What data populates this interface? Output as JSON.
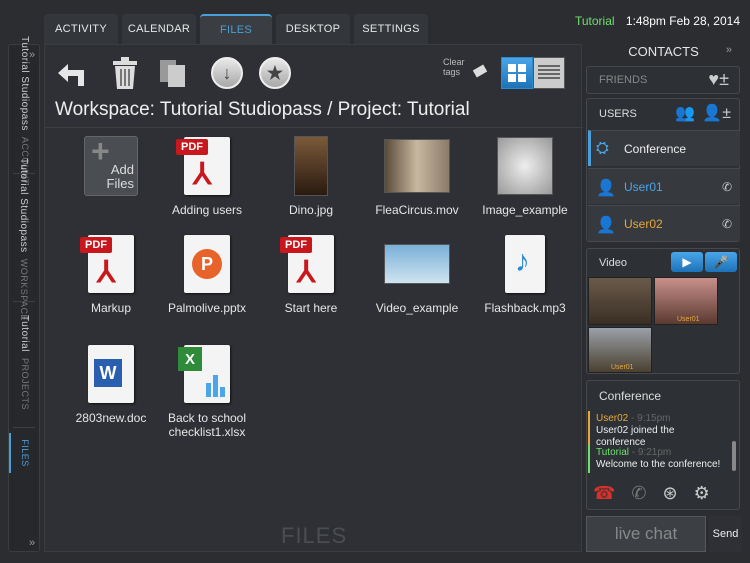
{
  "top_tabs": [
    "ACTIVITY",
    "CALENDAR",
    "FILES",
    "DESKTOP",
    "SETTINGS"
  ],
  "status": {
    "user": "Tutorial",
    "datetime": "1:48pm Feb 28, 2014"
  },
  "left_tabs": [
    {
      "header": "ACCOUNT",
      "value": "Tutorial Studiopass"
    },
    {
      "header": "WORKSPACE",
      "value": "Tutorial Studiopass"
    },
    {
      "header": "PROJECTS",
      "value": "Tutorial"
    },
    {
      "header": "FILES",
      "value": ""
    }
  ],
  "toolbar": {
    "clear_tags": "Clear tags"
  },
  "breadcrumb": "Workspace: Tutorial Studiopass / Project: Tutorial",
  "files": [
    {
      "name": "Add Files",
      "type": "add"
    },
    {
      "name": "Adding users",
      "type": "pdf"
    },
    {
      "name": "Dino.jpg",
      "type": "image"
    },
    {
      "name": "FleaCircus.mov",
      "type": "video"
    },
    {
      "name": "Image_example",
      "type": "image"
    },
    {
      "name": "Markup",
      "type": "pdf"
    },
    {
      "name": "Palmolive.pptx",
      "type": "pptx"
    },
    {
      "name": "Start here",
      "type": "pdf"
    },
    {
      "name": "Video_example",
      "type": "video"
    },
    {
      "name": "Flashback.mp3",
      "type": "audio"
    },
    {
      "name": "2803new.doc",
      "type": "doc"
    },
    {
      "name": "Back to school checklist1.xlsx",
      "type": "xlsx"
    }
  ],
  "add_files_label": "Add Files",
  "pdf_badge": "PDF",
  "footer_label": "FILES",
  "contacts": {
    "title": "CONTACTS",
    "friends": "FRIENDS",
    "users": "USERS",
    "conference": "Conference",
    "user_list": [
      {
        "name": "User01",
        "color": "#4aa6e8"
      },
      {
        "name": "User02",
        "color": "#e8a83a"
      }
    ]
  },
  "video": {
    "title": "Video",
    "tile_labels": [
      "User01",
      "User01"
    ]
  },
  "chat": {
    "title": "Conference",
    "messages": [
      {
        "user": "User02",
        "time": "9:15pm",
        "text": "User02 joined the conference",
        "color": "#e8a83a"
      },
      {
        "user": "Tutorial",
        "time": "9:21pm",
        "text": "Welcome to the conference!",
        "color": "#6ee06e"
      }
    ],
    "input_placeholder": "live chat",
    "send": "Send"
  }
}
